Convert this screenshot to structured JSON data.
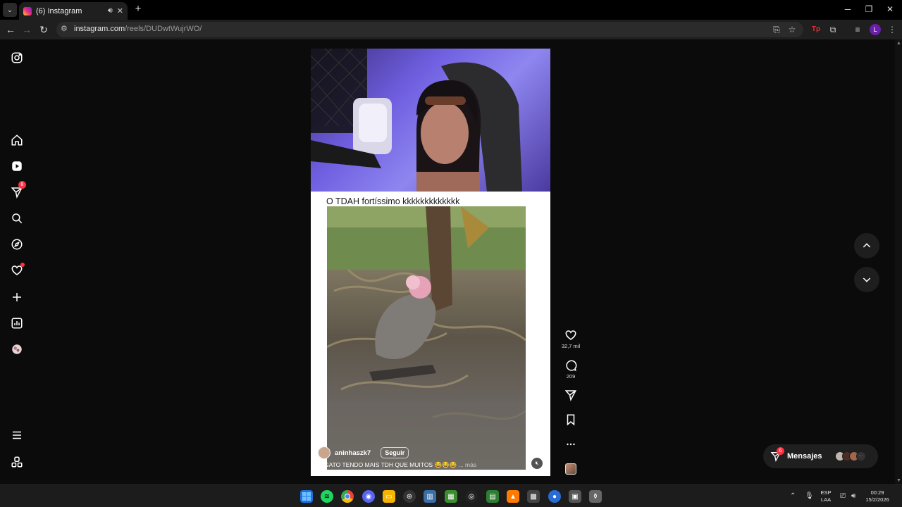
{
  "browser": {
    "tab_title": "(6) Instagram",
    "url_host": "instagram.com",
    "url_path": "/reels/DUDwtWujrWO/"
  },
  "sidebar": {
    "notifications_badge": "8",
    "items": [
      "instagram-logo",
      "home",
      "reels",
      "messages",
      "search",
      "explore",
      "notifications",
      "create",
      "dashboard",
      "profile",
      "more",
      "also-from-meta"
    ]
  },
  "reel": {
    "caption": "O TDAH fortíssimo kkkkkkkkkkkkk",
    "username": "aninhaszk7",
    "follow_label": "Seguir",
    "description": "O GATO TENDO MAIS TDH QUE MUITOS 😂😂😂",
    "more_label": "... más"
  },
  "actions": {
    "likes": "32,7 mil",
    "comments": "209"
  },
  "messages": {
    "label": "Mensajes",
    "badge": "6"
  },
  "taskbar": {
    "lang_line1": "ESP",
    "lang_line2": "LAA",
    "time": "00:29",
    "date": "15/2/2026"
  },
  "colors": {
    "notification_red": "#ff3040",
    "page_bg": "#0b0b0b"
  }
}
